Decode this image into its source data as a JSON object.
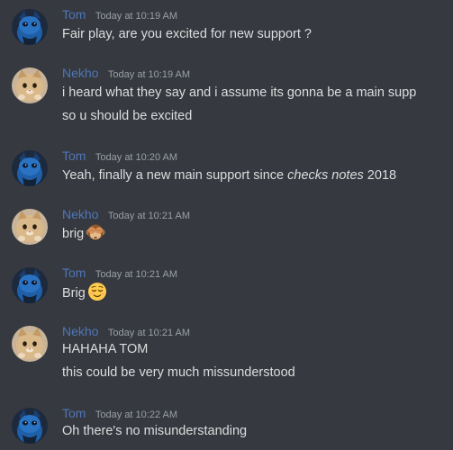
{
  "messages": [
    {
      "author": "Tom",
      "timestamp": "Today at 10:19 AM",
      "avatar_icon": "blue-cat-avatar-icon",
      "lines": [
        "Fair play, are you excited for new support ?"
      ]
    },
    {
      "author": "Nekho",
      "timestamp": "Today at 10:19 AM",
      "avatar_icon": "tan-cat-avatar-icon",
      "lines": [
        "i heard what they say and i assume its gonna be a main supp",
        "so u should be excited"
      ]
    },
    {
      "author": "Tom",
      "timestamp": "Today at 10:20 AM",
      "avatar_icon": "blue-cat-avatar-icon",
      "line_parts": {
        "before": "Yeah, finally a new main support since ",
        "italic": "checks notes",
        "after": " 2018"
      }
    },
    {
      "author": "Nekho",
      "timestamp": "Today at 10:21 AM",
      "avatar_icon": "tan-cat-avatar-icon",
      "lines": [
        "brig"
      ],
      "emoji": "see-no-evil-monkey-emoji"
    },
    {
      "author": "Tom",
      "timestamp": "Today at 10:21 AM",
      "avatar_icon": "blue-cat-avatar-icon",
      "lines": [
        "Brig"
      ],
      "emoji": "relieved-face-emoji"
    },
    {
      "author": "Nekho",
      "timestamp": "Today at 10:21 AM",
      "avatar_icon": "tan-cat-avatar-icon",
      "lines": [
        "HAHAHA TOM",
        "this could be very much missunderstood"
      ]
    },
    {
      "author": "Tom",
      "timestamp": "Today at 10:22 AM",
      "avatar_icon": "blue-cat-avatar-icon",
      "lines": [
        "Oh there's no misunderstanding"
      ]
    }
  ],
  "colors": {
    "background": "#36393f",
    "author": "#4f76b8",
    "text": "#dcddde",
    "timestamp": "#9aa0a6"
  }
}
